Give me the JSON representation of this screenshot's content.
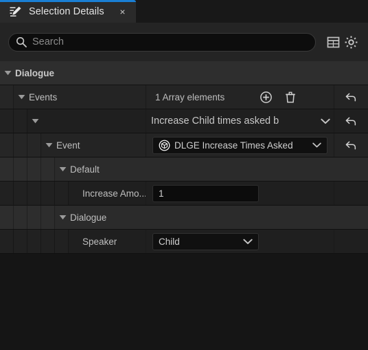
{
  "tab": {
    "title": "Selection Details",
    "icon": "details-pencil-icon",
    "close_label": "×",
    "accent_color": "#1a7fd4"
  },
  "search": {
    "placeholder": "Search",
    "value": "",
    "icon": "search-icon",
    "table_view_icon": "table-icon",
    "settings_icon": "gear-icon"
  },
  "details": {
    "categories": [
      {
        "name": "Dialogue",
        "expanded": true
      }
    ],
    "rows": {
      "events": {
        "label": "Events",
        "value": "1 Array elements",
        "add_icon": "plus-circle-icon",
        "delete_icon": "trash-icon",
        "reset_icon": "reset-arrow-icon"
      },
      "array_element": {
        "label": "",
        "value": "Increase Child times asked b",
        "chevron_icon": "chevron-down-icon",
        "reset_icon": "reset-arrow-icon"
      },
      "event": {
        "label": "Event",
        "value": "DLGE Increase Times Asked",
        "class_icon": "blueprint-class-icon",
        "chevron_icon": "chevron-down-icon",
        "reset_icon": "reset-arrow-icon"
      },
      "default_section": {
        "label": "Default"
      },
      "increase_amount": {
        "label": "Increase Amo...",
        "value": "1"
      },
      "dialogue_section": {
        "label": "Dialogue"
      },
      "speaker": {
        "label": "Speaker",
        "value": "Child",
        "chevron_icon": "chevron-down-icon"
      }
    }
  }
}
